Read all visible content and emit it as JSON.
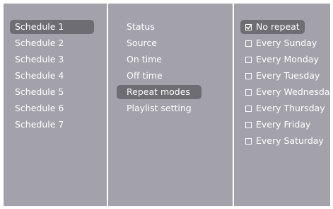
{
  "schedules": {
    "items": [
      "Schedule 1",
      "Schedule 2",
      "Schedule 3",
      "Schedule 4",
      "Schedule 5",
      "Schedule 6",
      "Schedule 7"
    ],
    "selected": "Schedule 1"
  },
  "settings": {
    "items": [
      "Status",
      "Source",
      "On time",
      "Off time",
      "Repeat modes",
      "Playlist setting"
    ],
    "selected": "Repeat modes"
  },
  "repeat_modes": {
    "options": [
      {
        "label": "No repeat",
        "checked": true
      },
      {
        "label": "Every Sunday",
        "checked": false
      },
      {
        "label": "Every Monday",
        "checked": false
      },
      {
        "label": "Every Tuesday",
        "checked": false
      },
      {
        "label": "Every Wednesday",
        "checked": false
      },
      {
        "label": "Every Thursday",
        "checked": false
      },
      {
        "label": "Every Friday",
        "checked": false
      },
      {
        "label": "Every Saturday",
        "checked": false
      }
    ],
    "selected": "No repeat"
  },
  "colors": {
    "panel": "#a3a2ab",
    "highlight": "#6e6d73",
    "text": "#ffffff"
  }
}
